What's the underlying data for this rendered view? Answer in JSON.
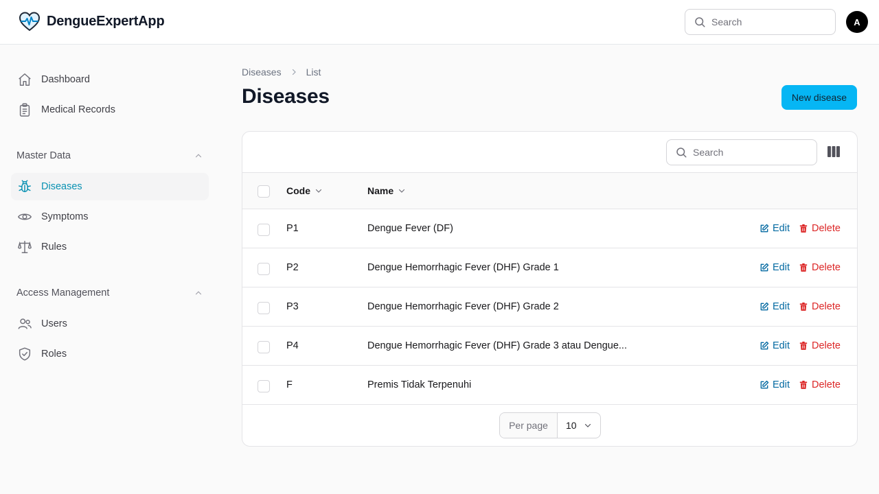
{
  "header": {
    "brand": "DengueExpertApp",
    "search_placeholder": "Search",
    "avatar_initial": "A",
    "logo_icon": "heart-pulse-icon"
  },
  "sidebar": {
    "items": [
      {
        "label": "Dashboard",
        "icon": "home-icon"
      },
      {
        "label": "Medical Records",
        "icon": "clipboard-icon"
      }
    ],
    "groups": [
      {
        "label": "Master Data",
        "items": [
          {
            "label": "Diseases",
            "icon": "bug-icon",
            "active": true
          },
          {
            "label": "Symptoms",
            "icon": "eye-icon"
          },
          {
            "label": "Rules",
            "icon": "scale-icon"
          }
        ]
      },
      {
        "label": "Access Management",
        "items": [
          {
            "label": "Users",
            "icon": "users-icon"
          },
          {
            "label": "Roles",
            "icon": "shield-check-icon"
          }
        ]
      }
    ]
  },
  "main": {
    "breadcrumb": [
      "Diseases",
      "List"
    ],
    "title": "Diseases",
    "new_button": "New disease",
    "table": {
      "search_placeholder": "Search",
      "columns": [
        "Code",
        "Name"
      ],
      "rows": [
        {
          "code": "P1",
          "name": "Dengue Fever (DF)"
        },
        {
          "code": "P2",
          "name": "Dengue Hemorrhagic Fever (DHF) Grade 1"
        },
        {
          "code": "P3",
          "name": "Dengue Hemorrhagic Fever (DHF) Grade 2"
        },
        {
          "code": "P4",
          "name": "Dengue Hemorrhagic Fever (DHF) Grade 3 atau Dengue..."
        },
        {
          "code": "F",
          "name": "Premis Tidak Terpenuhi"
        }
      ],
      "edit_label": "Edit",
      "delete_label": "Delete",
      "per_page_label": "Per page",
      "per_page_value": "10"
    }
  },
  "colors": {
    "accent": "#06b6f4",
    "active_nav": "#0891b2",
    "edit": "#0369a1",
    "delete": "#dc2626"
  }
}
